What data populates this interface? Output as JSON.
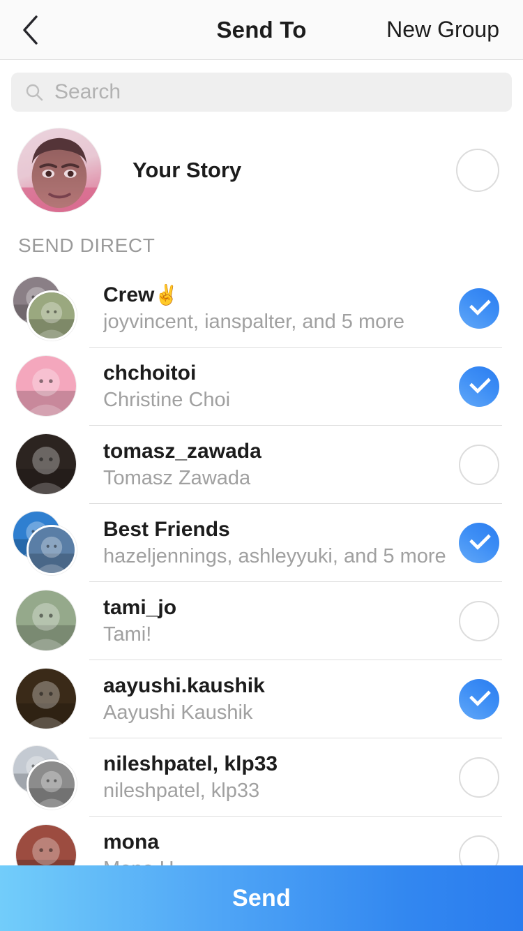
{
  "header": {
    "back_icon": "chevron-left-icon",
    "title": "Send To",
    "action_label": "New Group"
  },
  "search": {
    "icon": "search-icon",
    "placeholder": "Search",
    "value": ""
  },
  "story": {
    "label": "Your Story",
    "selected": false,
    "avatar": "self-portrait-photo"
  },
  "section": {
    "label": "SEND DIRECT"
  },
  "colors": {
    "accent_blue": "#3d8ef5",
    "accent_blue_dark": "#2a7cee",
    "accent_blue_light": "#72cdfa",
    "text_primary": "#1c1c1c",
    "text_secondary": "#a0a0a0",
    "section_label": "#9a9a9a",
    "search_bg": "#efefef",
    "header_bg": "#fafafa",
    "separator": "#dedede",
    "ring_off": "#dcdcdc"
  },
  "recipients": [
    {
      "title": "Crew",
      "emoji": "✌️",
      "subtitle": "joyvincent, ianspalter, and 5 more",
      "selected": true,
      "avatar_type": "group",
      "avatar_back": "#8a7f86",
      "avatar_front": "#9aa87f"
    },
    {
      "title": "chchoitoi",
      "emoji": "",
      "subtitle": "Christine Choi",
      "selected": true,
      "avatar_type": "single",
      "avatar_back": "#f4a7bd",
      "avatar_front": "#f4a7bd"
    },
    {
      "title": "tomasz_zawada",
      "emoji": "",
      "subtitle": "Tomasz Zawada",
      "selected": false,
      "avatar_type": "single",
      "avatar_back": "#2c2420",
      "avatar_front": "#2c2420"
    },
    {
      "title": "Best Friends",
      "emoji": "",
      "subtitle": "hazeljennings, ashleyyuki, and 5 more",
      "selected": true,
      "avatar_type": "group",
      "avatar_back": "#2f7fd0",
      "avatar_front": "#5a7ea6"
    },
    {
      "title": "tami_jo",
      "emoji": "",
      "subtitle": "Tami!",
      "selected": false,
      "avatar_type": "single",
      "avatar_back": "#95a98b",
      "avatar_front": "#95a98b"
    },
    {
      "title": "aayushi.kaushik",
      "emoji": "",
      "subtitle": "Aayushi Kaushik",
      "selected": true,
      "avatar_type": "single",
      "avatar_back": "#3a2a18",
      "avatar_front": "#3a2a18"
    },
    {
      "title": "nileshpatel, klp33",
      "emoji": "",
      "subtitle": "nileshpatel, klp33",
      "selected": false,
      "avatar_type": "group",
      "avatar_back": "#c4cad2",
      "avatar_front": "#8c8c8c"
    },
    {
      "title": "mona",
      "emoji": "",
      "subtitle": "Mona H",
      "selected": false,
      "avatar_type": "single",
      "avatar_back": "#9c4c40",
      "avatar_front": "#9c4c40"
    }
  ],
  "send_button": {
    "label": "Send"
  }
}
